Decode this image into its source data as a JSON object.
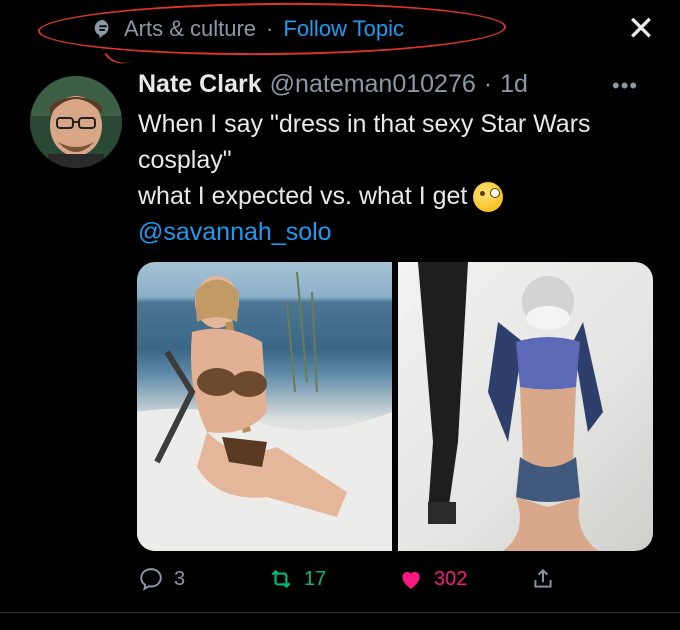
{
  "topic": {
    "category": "Arts & culture",
    "separator": "·",
    "follow_label": "Follow Topic",
    "close_icon": "close-icon"
  },
  "tweet": {
    "author_name": "Nate Clark",
    "author_handle": "@nateman010276",
    "dot": "·",
    "time": "1d",
    "more_icon": "more-icon",
    "text_lines": [
      "When I say \"dress in that sexy Star Wars",
      "cosplay\"",
      "what I expected  vs.  what I get"
    ],
    "emoji": "zany-face-emoji",
    "mention": "@savannah_solo"
  },
  "actions": {
    "replies": "3",
    "retweets": "17",
    "likes": "302",
    "reply_icon": "reply-icon",
    "retweet_icon": "retweet-icon",
    "like_icon": "heart-icon",
    "share_icon": "share-icon"
  },
  "colors": {
    "background": "#000000",
    "accent": "#1d9bf0",
    "muted": "#8b98a5",
    "retweet": "#00ba7c",
    "like": "#f91880",
    "annotation": "#d9352b"
  }
}
